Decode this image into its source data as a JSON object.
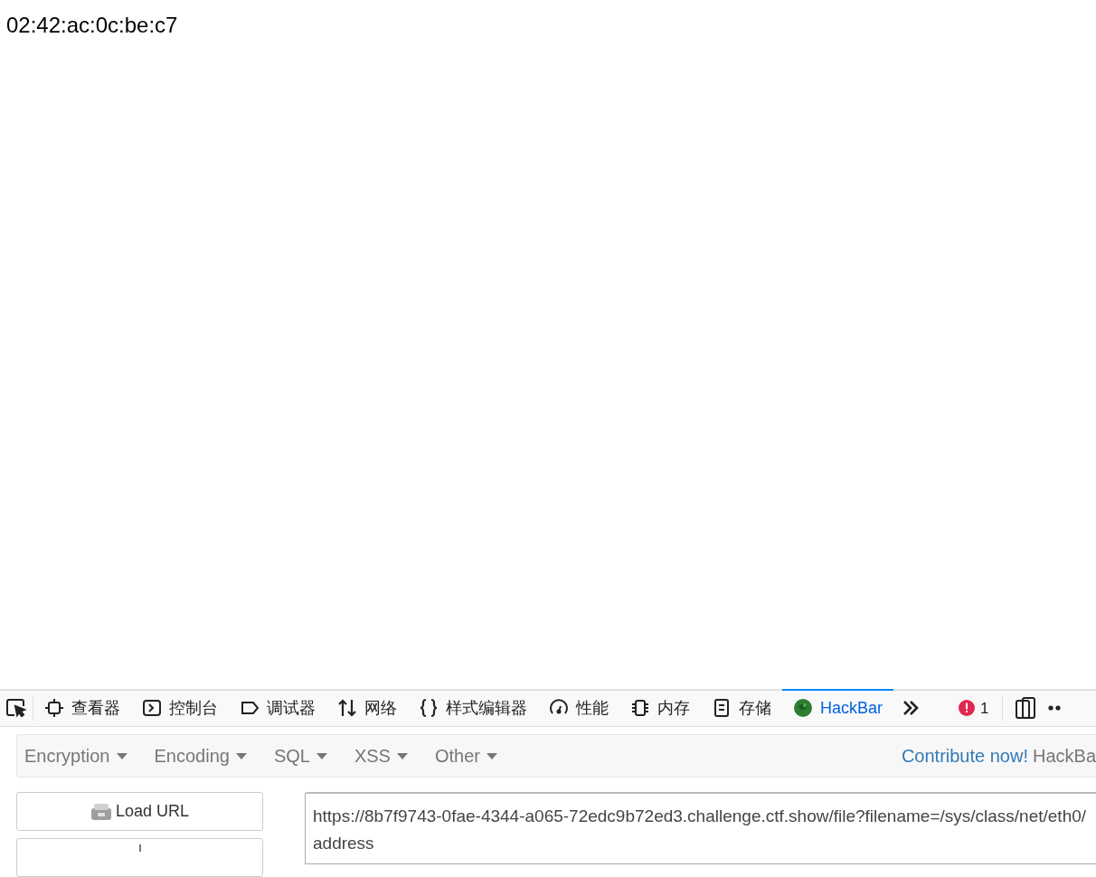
{
  "page": {
    "text": "02:42:ac:0c:be:c7"
  },
  "devtools_tabs": [
    {
      "kind": "inspector",
      "label": "查看器",
      "selected": false
    },
    {
      "kind": "console",
      "label": "控制台",
      "selected": false
    },
    {
      "kind": "debugger",
      "label": "调试器",
      "selected": false
    },
    {
      "kind": "network",
      "label": "网络",
      "selected": false
    },
    {
      "kind": "style",
      "label": "样式编辑器",
      "selected": false
    },
    {
      "kind": "performance",
      "label": "性能",
      "selected": false
    },
    {
      "kind": "memory",
      "label": "内存",
      "selected": false
    },
    {
      "kind": "storage",
      "label": "存储",
      "selected": false
    },
    {
      "kind": "hackbar",
      "label": "HackBar",
      "selected": true
    }
  ],
  "error_count": "1",
  "hackbar": {
    "menus": [
      "Encryption",
      "Encoding",
      "SQL",
      "XSS",
      "Other"
    ],
    "contribute_link": "Contribute now!",
    "brand": "HackBa",
    "load_button": "Load URL",
    "url": "https://8b7f9743-0fae-4344-a065-72edc9b72ed3.challenge.ctf.show/file?filename=/sys/class/net/eth0/address"
  }
}
